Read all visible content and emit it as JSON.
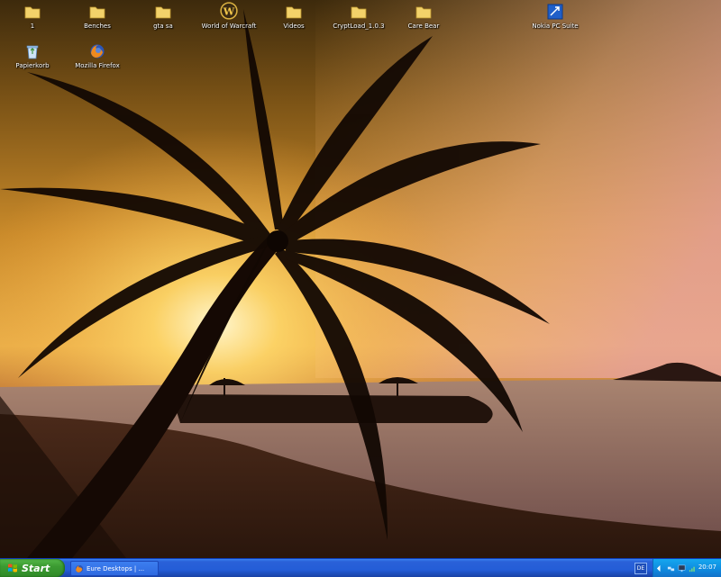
{
  "desktop": {
    "icons": [
      {
        "label": "1",
        "icon": "folder-icon"
      },
      {
        "label": "Benches",
        "icon": "folder-icon"
      },
      {
        "label": "gta sa",
        "icon": "folder-icon"
      },
      {
        "label": "World of Warcraft",
        "icon": "wow-icon"
      },
      {
        "label": "Videos",
        "icon": "folder-icon"
      },
      {
        "label": "CryptLoad_1.0.3",
        "icon": "folder-icon"
      },
      {
        "label": "Care Bear",
        "icon": "folder-icon"
      },
      {
        "label": "Nokia PC Suite",
        "icon": "app-shortcut-icon"
      },
      {
        "label": "Papierkorb",
        "icon": "recycle-bin-icon"
      },
      {
        "label": "Mozilla Firefox",
        "icon": "firefox-icon"
      }
    ]
  },
  "taskbar": {
    "start_label": "Start",
    "task_label": "Eure Desktops | ...",
    "language": "DE",
    "clock": "20:07"
  },
  "colors": {
    "taskbar_blue": "#245dd7",
    "start_green": "#3c9b32",
    "tray_blue": "#0f89de"
  }
}
